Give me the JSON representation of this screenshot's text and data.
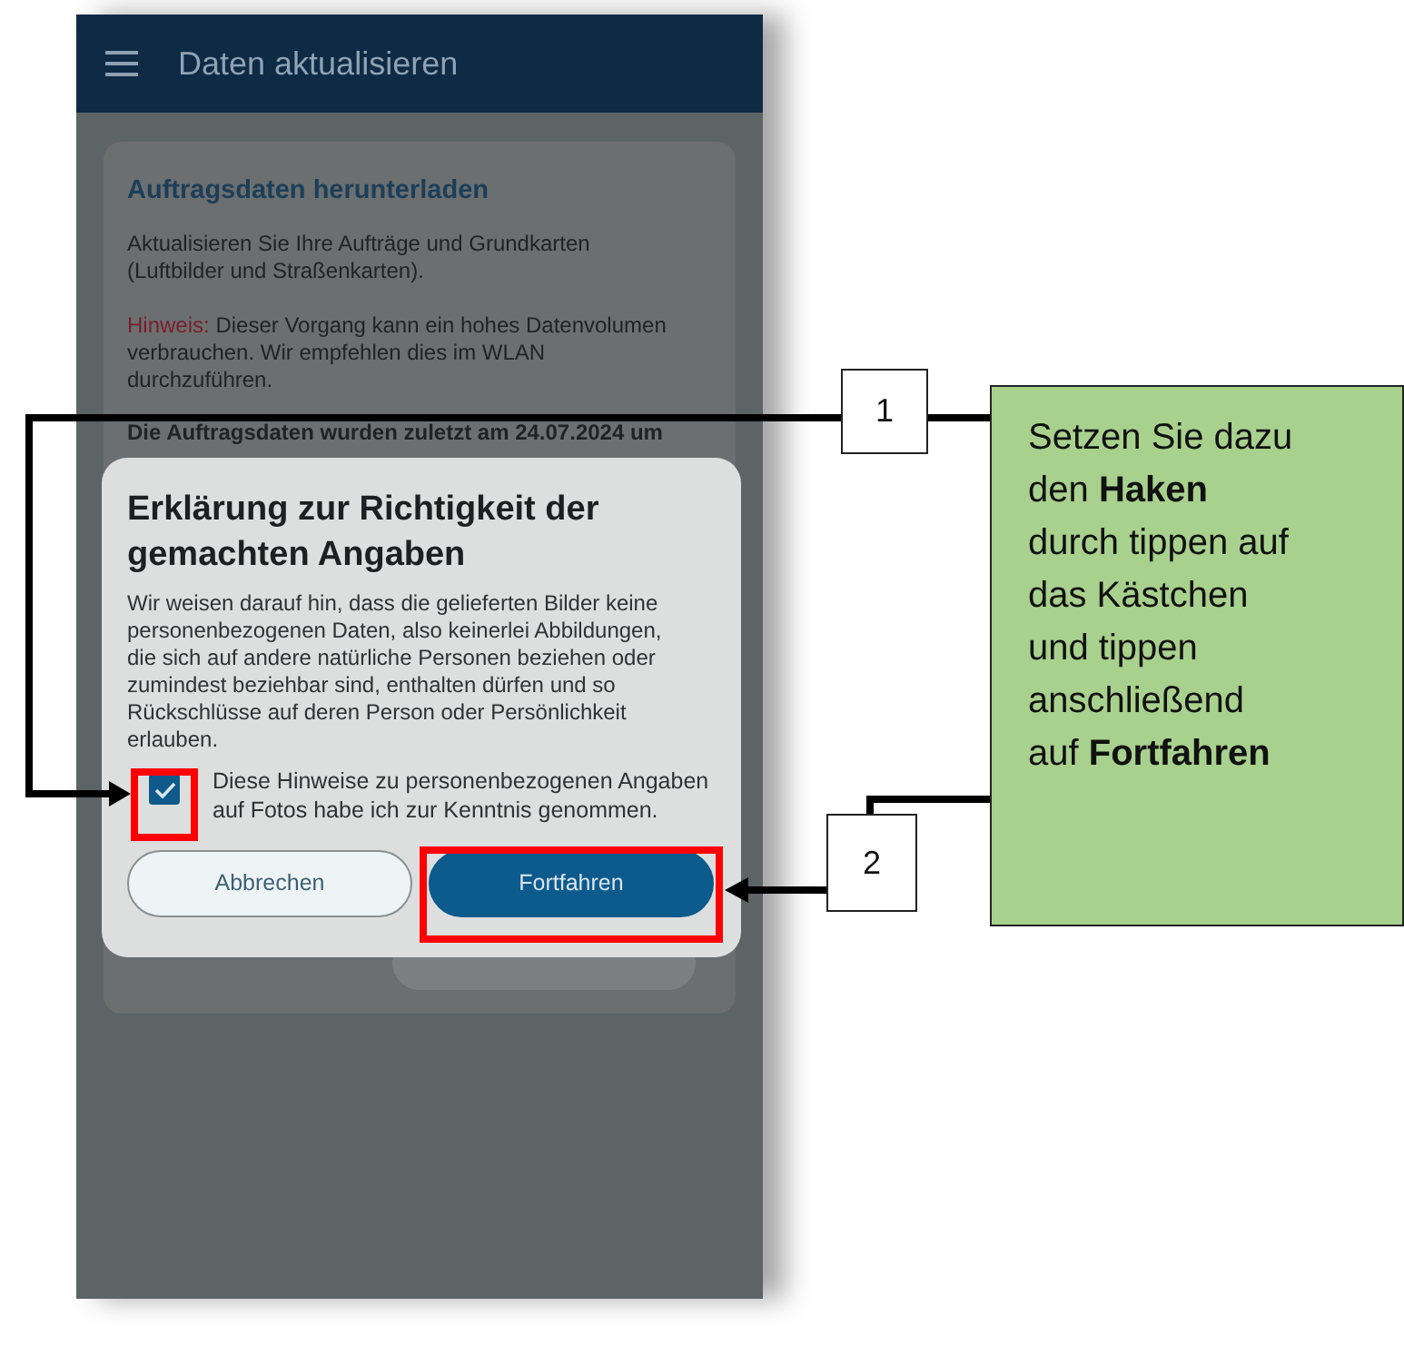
{
  "app_bar": {
    "title": "Daten aktualisieren"
  },
  "card": {
    "title": "Auftragsdaten herunterladen",
    "intro": "Aktualisieren Sie Ihre Aufträge und Grundkarten (Luftbilder und Straßenkarten).",
    "hint_label": "Hinweis:",
    "hint_text": "Dieser Vorgang kann ein hohes Datenvolumen verbrauchen. Wir empfehlen dies im WLAN durchzuführen.",
    "status": "Die Auftragsdaten wurden zuletzt am 24.07.2024 um"
  },
  "dialog": {
    "title": "Erklärung zur Richtigkeit der gemachten Angaben",
    "body": "Wir weisen darauf hin, dass die gelieferten Bilder keine personenbezogenen Daten, also keinerlei Abbildungen, die sich auf andere natürliche Personen beziehen oder zumindest beziehbar sind, enthalten dürfen und so Rückschlüsse auf deren Person oder Persönlichkeit erlauben.",
    "checkbox": {
      "label": "Diese Hinweise zu personenbezogenen Angaben auf Fotos habe ich zur Kenntnis genommen.",
      "checked": true
    },
    "buttons": [
      {
        "label": "Abbrechen",
        "kind": "secondary"
      },
      {
        "label": "Fortfahren",
        "kind": "primary"
      }
    ]
  },
  "callouts": [
    {
      "number": "1"
    },
    {
      "number": "2"
    }
  ],
  "annotation": {
    "lines": [
      "Setzen Sie dazu",
      "den **Haken**",
      "durch tippen auf",
      "das Kästchen",
      "und tippen",
      "anschließend",
      "auf **Fortfahren**"
    ]
  }
}
